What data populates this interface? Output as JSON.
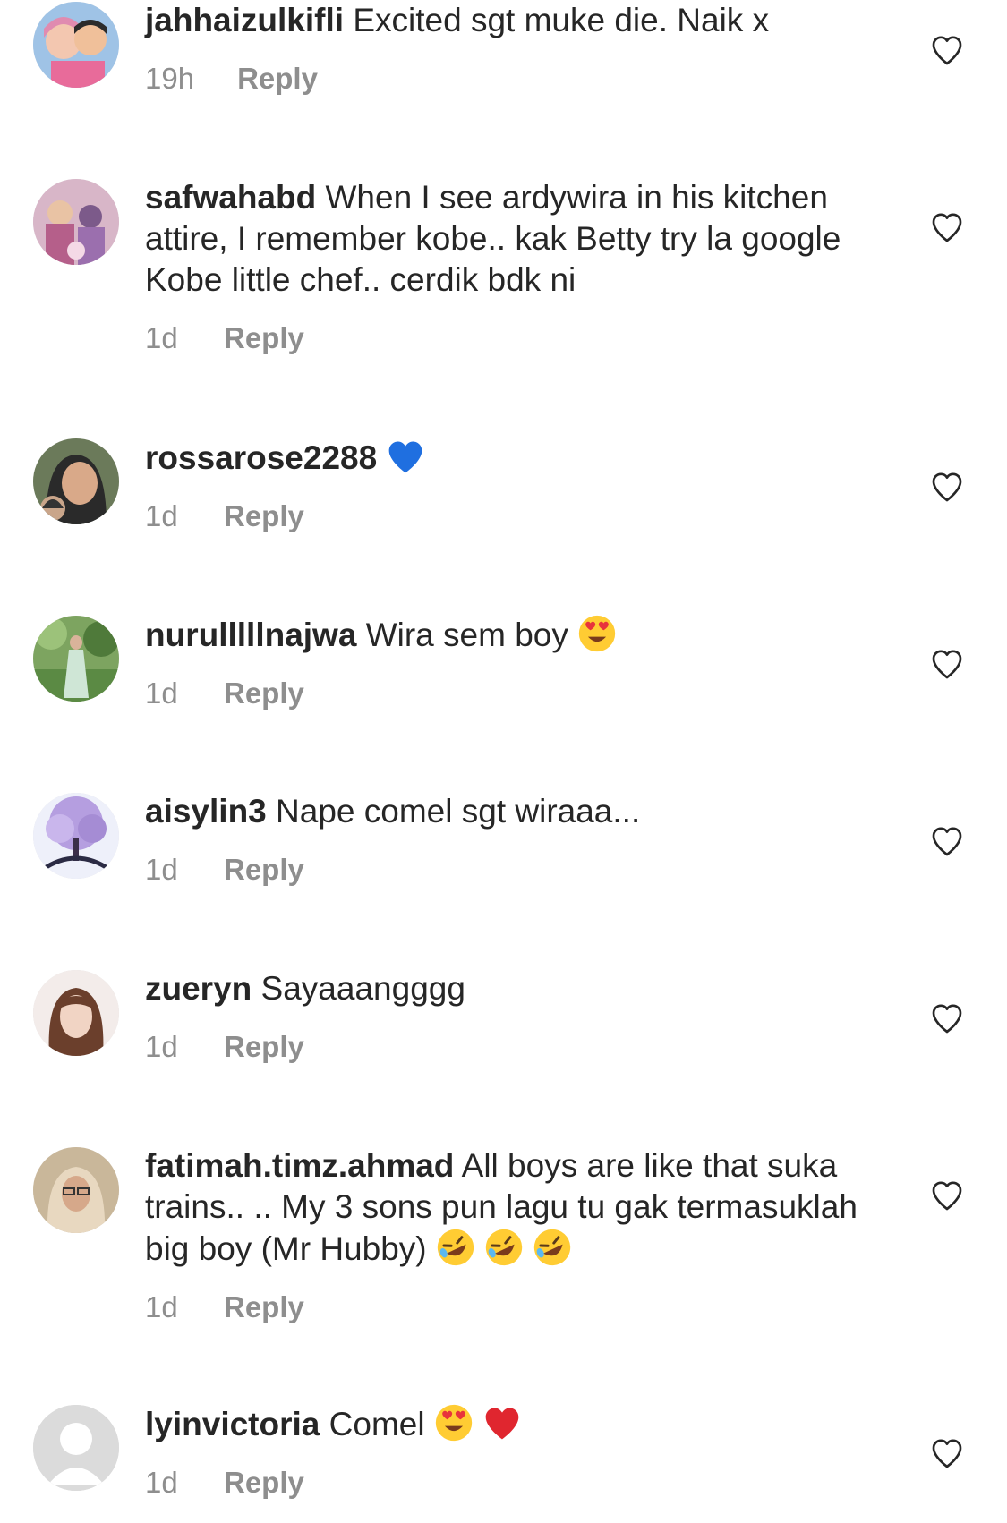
{
  "comments": [
    {
      "username": "jahhaizulkifli",
      "text": "Excited sgt muke die. Naik x",
      "time": "19h",
      "reply": "Reply",
      "emojis": []
    },
    {
      "username": "safwahabd",
      "text": "When I see ardywira in his kitchen attire, I remember kobe.. kak Betty try la google Kobe little chef.. cerdik bdk ni",
      "time": "1d",
      "reply": "Reply",
      "emojis": []
    },
    {
      "username": "rossarose2288",
      "text": "",
      "time": "1d",
      "reply": "Reply",
      "emojis": [
        "blue-heart"
      ]
    },
    {
      "username": "nurulllllnajwa",
      "text": "Wira sem boy",
      "time": "1d",
      "reply": "Reply",
      "emojis": [
        "heart-eyes"
      ]
    },
    {
      "username": "aisylin3",
      "text": "Nape comel sgt wiraaa...",
      "time": "1d",
      "reply": "Reply",
      "emojis": []
    },
    {
      "username": "zueryn",
      "text": "Sayaaangggg",
      "time": "1d",
      "reply": "Reply",
      "emojis": []
    },
    {
      "username": "fatimah.timz.ahmad",
      "text": "All boys are like that suka trains.. .. My 3 sons pun lagu tu gak termasuklah big boy (Mr Hubby)",
      "time": "1d",
      "reply": "Reply",
      "emojis": [
        "rofl",
        "rofl",
        "rofl"
      ]
    },
    {
      "username": "lyinvictoria",
      "text": "Comel",
      "time": "1d",
      "reply": "Reply",
      "emojis": [
        "heart-eyes",
        "red-heart"
      ]
    }
  ],
  "colors": {
    "text": "#262626",
    "meta": "#8e8e8e",
    "heart_outline": "#262626"
  }
}
